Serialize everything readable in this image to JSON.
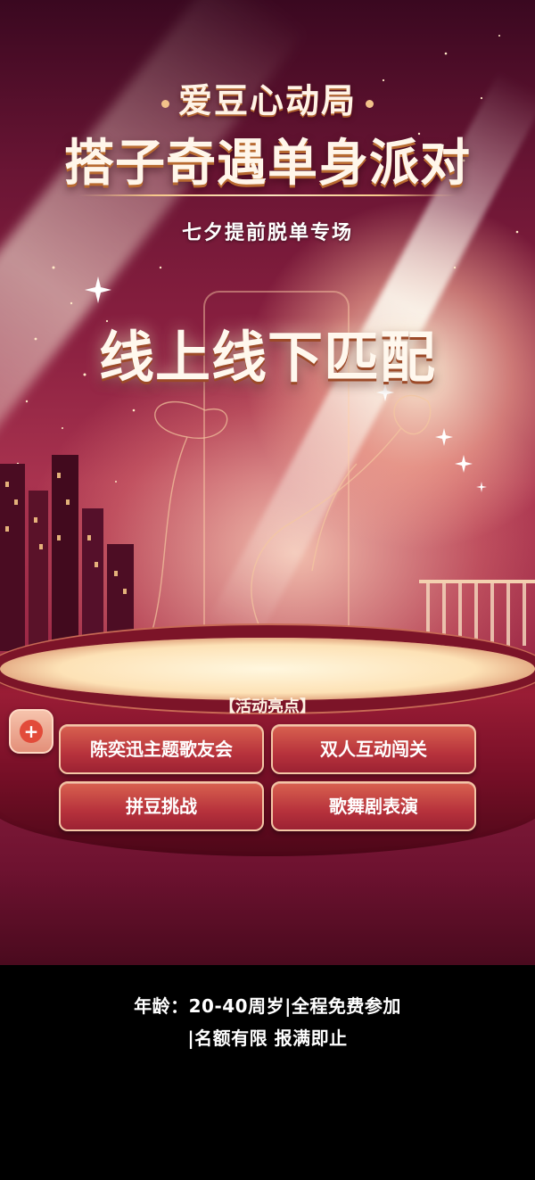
{
  "poster": {
    "title_top": "爱豆心动局",
    "title_main": "搭子奇遇单身派对",
    "subtitle": "七夕提前脱单专场",
    "headline": "线上线下匹配"
  },
  "highlights": {
    "title": "【活动亮点】",
    "plus_icon": "+",
    "items": [
      "陈奕迅主题歌友会",
      "双人互动闯关",
      "拼豆挑战",
      "歌舞剧表演"
    ]
  },
  "footer": {
    "line1": "年龄：20-40周岁|全程免费参加",
    "line2": "|名额有限 报满即止"
  },
  "colors": {
    "accent": "#a9334f",
    "gold": "#f7c98a",
    "button": "#b7323c"
  }
}
